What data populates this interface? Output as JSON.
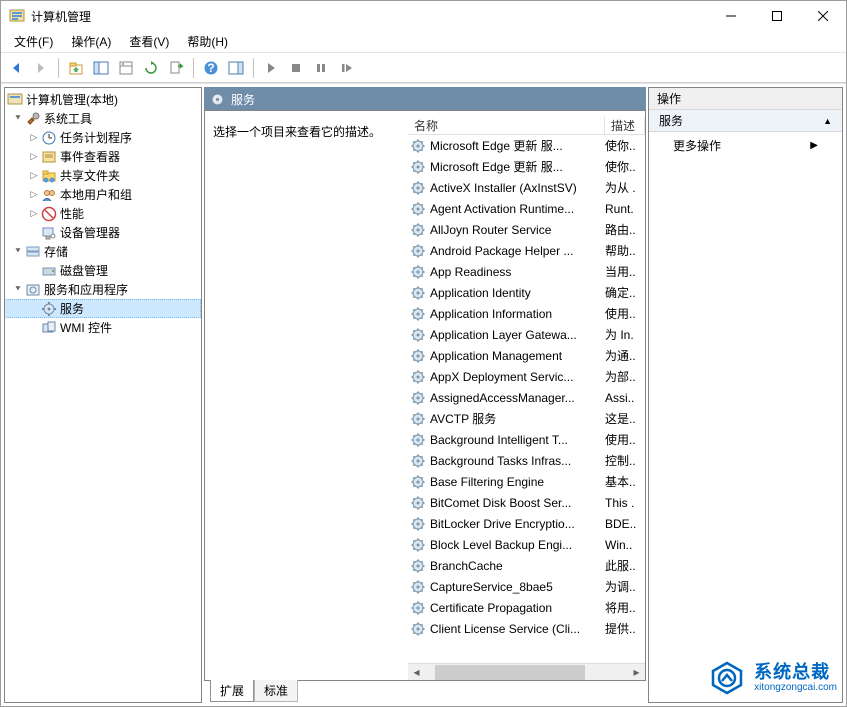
{
  "window": {
    "title": "计算机管理"
  },
  "menu": {
    "file": "文件(F)",
    "action": "操作(A)",
    "view": "查看(V)",
    "help": "帮助(H)"
  },
  "tree": {
    "root": "计算机管理(本地)",
    "sys_tools": "系统工具",
    "task_sched": "任务计划程序",
    "event_viewer": "事件查看器",
    "shared_folders": "共享文件夹",
    "local_users": "本地用户和组",
    "performance": "性能",
    "device_mgr": "设备管理器",
    "storage": "存储",
    "disk_mgmt": "磁盘管理",
    "services_apps": "服务和应用程序",
    "services": "服务",
    "wmi": "WMI 控件"
  },
  "center": {
    "header": "服务",
    "hint": "选择一个项目来查看它的描述。",
    "col_name": "名称",
    "col_desc": "描述"
  },
  "tabs": {
    "extended": "扩展",
    "standard": "标准"
  },
  "actions": {
    "title": "操作",
    "section": "服务",
    "more": "更多操作"
  },
  "watermark": {
    "cn": "系统总裁",
    "en": "xitongzongcai.com"
  },
  "services": [
    {
      "name": "Microsoft Edge 更新 服...",
      "desc": "使你.."
    },
    {
      "name": "Microsoft Edge 更新 服...",
      "desc": "使你.."
    },
    {
      "name": "ActiveX Installer (AxInstSV)",
      "desc": "为从 ."
    },
    {
      "name": "Agent Activation Runtime...",
      "desc": "Runt."
    },
    {
      "name": "AllJoyn Router Service",
      "desc": "路由.."
    },
    {
      "name": "Android Package Helper ...",
      "desc": "帮助.."
    },
    {
      "name": "App Readiness",
      "desc": "当用.."
    },
    {
      "name": "Application Identity",
      "desc": "确定.."
    },
    {
      "name": "Application Information",
      "desc": "使用.."
    },
    {
      "name": "Application Layer Gatewa...",
      "desc": "为 In."
    },
    {
      "name": "Application Management",
      "desc": "为通.."
    },
    {
      "name": "AppX Deployment Servic...",
      "desc": "为部.."
    },
    {
      "name": "AssignedAccessManager...",
      "desc": "Assi.."
    },
    {
      "name": "AVCTP 服务",
      "desc": "这是.."
    },
    {
      "name": "Background Intelligent T...",
      "desc": "使用.."
    },
    {
      "name": "Background Tasks Infras...",
      "desc": "控制.."
    },
    {
      "name": "Base Filtering Engine",
      "desc": "基本.."
    },
    {
      "name": "BitComet Disk Boost Ser...",
      "desc": "This ."
    },
    {
      "name": "BitLocker Drive Encryptio...",
      "desc": "BDE.."
    },
    {
      "name": "Block Level Backup Engi...",
      "desc": "Win.."
    },
    {
      "name": "BranchCache",
      "desc": "此服.."
    },
    {
      "name": "CaptureService_8bae5",
      "desc": "为调.."
    },
    {
      "name": "Certificate Propagation",
      "desc": "将用.."
    },
    {
      "name": "Client License Service (Cli...",
      "desc": "提供.."
    }
  ]
}
